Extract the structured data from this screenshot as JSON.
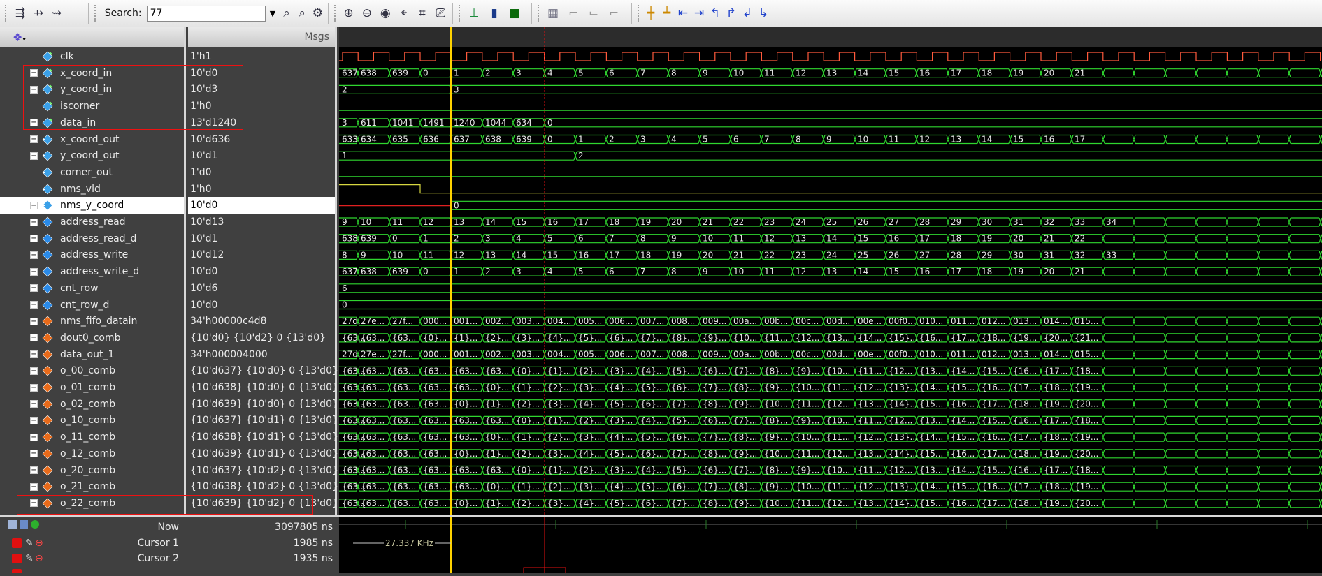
{
  "toolbar": {
    "search_label": "Search:",
    "search_value": "77",
    "group1_icons": [
      "insert-wave-icon",
      "insert-divider-icon",
      "find-signal-icon"
    ],
    "group2_icons": [
      "find-prev-icon",
      "find-next-icon",
      "find-options-icon"
    ],
    "group3_icons": [
      "wave-settings-icon"
    ],
    "group4_icons": [
      "zoom-in-icon",
      "zoom-out-icon",
      "zoom-full-icon",
      "zoom-cursor-icon",
      "zoom-region-icon",
      "zoom-last-icon"
    ],
    "group5_icons": [
      "format-literal-icon",
      "format-logic-icon",
      "format-analog-icon"
    ],
    "group6_icons": [
      "block-icon",
      "edge-rise-icon",
      "edge-fall-icon",
      "edge-both-icon"
    ],
    "group7_icons": [
      "add-cursor-icon",
      "delete-cursor-icon",
      "cursor-prev-edge-icon",
      "cursor-next-edge-icon",
      "cursor-prev-rise-icon",
      "cursor-next-rise-icon",
      "cursor-prev-fall-icon",
      "cursor-next-fall-icon"
    ]
  },
  "value_header": "Msgs",
  "signals": [
    {
      "name": "clk",
      "value": "1'h1",
      "kind": "in",
      "expandable": false,
      "wave": "clock"
    },
    {
      "name": "x_coord_in",
      "value": "10'd0",
      "kind": "in",
      "expandable": true,
      "wave": "bus",
      "segs": [
        "637",
        "638",
        "639",
        "0",
        "1",
        "2",
        "3",
        "4",
        "5",
        "6",
        "7",
        "8",
        "9",
        "10",
        "11",
        "12",
        "13",
        "14",
        "15",
        "16",
        "17",
        "18",
        "19",
        "20",
        "21"
      ]
    },
    {
      "name": "y_coord_in",
      "value": "10'd3",
      "kind": "in",
      "expandable": true,
      "wave": "bus2",
      "first": "2",
      "second": "3"
    },
    {
      "name": "iscorner",
      "value": "1'h0",
      "kind": "in",
      "expandable": false,
      "wave": "low"
    },
    {
      "name": "data_in",
      "value": "13'd1240",
      "kind": "in",
      "expandable": true,
      "wave": "data",
      "segs": [
        "3",
        "611",
        "1041",
        "1491",
        "1240",
        "1044",
        "634",
        "0"
      ]
    },
    {
      "name": "x_coord_out",
      "value": "10'd636",
      "kind": "out",
      "expandable": true,
      "wave": "busx",
      "segs": [
        "633",
        "634",
        "635",
        "636",
        "637",
        "638",
        "639",
        "0",
        "1",
        "2",
        "3",
        "4",
        "5",
        "6",
        "7",
        "8",
        "9",
        "10",
        "11",
        "12",
        "13",
        "14",
        "15",
        "16",
        "17"
      ]
    },
    {
      "name": "y_coord_out",
      "value": "10'd1",
      "kind": "out",
      "expandable": true,
      "wave": "ybus",
      "first": "1",
      "second": "2"
    },
    {
      "name": "corner_out",
      "value": "1'd0",
      "kind": "out",
      "expandable": false,
      "wave": "low"
    },
    {
      "name": "nms_vld",
      "value": "1'h0",
      "kind": "out",
      "expandable": false,
      "wave": "vld"
    },
    {
      "name": "nms_y_coord",
      "value": "10'd0",
      "kind": "out",
      "expandable": true,
      "wave": "nmsy",
      "first": "0",
      "selected": true
    },
    {
      "name": "address_read",
      "value": "10'd13",
      "kind": "int",
      "expandable": true,
      "wave": "bus",
      "segs": [
        "9",
        "10",
        "11",
        "12",
        "13",
        "14",
        "15",
        "16",
        "17",
        "18",
        "19",
        "20",
        "21",
        "22",
        "23",
        "24",
        "25",
        "26",
        "27",
        "28",
        "29",
        "30",
        "31",
        "32",
        "33",
        "34"
      ]
    },
    {
      "name": "address_read_d",
      "value": "10'd1",
      "kind": "int",
      "expandable": true,
      "wave": "bus",
      "segs": [
        "638",
        "639",
        "0",
        "1",
        "2",
        "3",
        "4",
        "5",
        "6",
        "7",
        "8",
        "9",
        "10",
        "11",
        "12",
        "13",
        "14",
        "15",
        "16",
        "17",
        "18",
        "19",
        "20",
        "21",
        "22"
      ]
    },
    {
      "name": "address_write",
      "value": "10'd12",
      "kind": "int",
      "expandable": true,
      "wave": "bus",
      "segs": [
        "8",
        "9",
        "10",
        "11",
        "12",
        "13",
        "14",
        "15",
        "16",
        "17",
        "18",
        "19",
        "20",
        "21",
        "22",
        "23",
        "24",
        "25",
        "26",
        "27",
        "28",
        "29",
        "30",
        "31",
        "32",
        "33"
      ]
    },
    {
      "name": "address_write_d",
      "value": "10'd0",
      "kind": "int",
      "expandable": true,
      "wave": "bus",
      "segs": [
        "637",
        "638",
        "639",
        "0",
        "1",
        "2",
        "3",
        "4",
        "5",
        "6",
        "7",
        "8",
        "9",
        "10",
        "11",
        "12",
        "13",
        "14",
        "15",
        "16",
        "17",
        "18",
        "19",
        "20",
        "21"
      ]
    },
    {
      "name": "cnt_row",
      "value": "10'd6",
      "kind": "int",
      "expandable": true,
      "wave": "const",
      "first": "6"
    },
    {
      "name": "cnt_row_d",
      "value": "10'd0",
      "kind": "int",
      "expandable": true,
      "wave": "const",
      "first": "0"
    },
    {
      "name": "nms_fifo_datain",
      "value": "34'h00000c4d8",
      "kind": "reg",
      "expandable": true,
      "wave": "bus",
      "segs": [
        "27d...",
        "27e...",
        "27f...",
        "000...",
        "001...",
        "002...",
        "003...",
        "004...",
        "005...",
        "006...",
        "007...",
        "008...",
        "009...",
        "00a...",
        "00b...",
        "00c...",
        "00d...",
        "00e...",
        "00f0...",
        "010...",
        "011...",
        "012...",
        "013...",
        "014...",
        "015..."
      ]
    },
    {
      "name": "dout0_comb",
      "value": "{10'd0} {10'd2} 0 {13'd0}",
      "kind": "reg",
      "expandable": true,
      "wave": "bus",
      "segs": [
        "{63...",
        "{63...",
        "{63...",
        "{0}...",
        "{1}...",
        "{2}...",
        "{3}...",
        "{4}...",
        "{5}...",
        "{6}...",
        "{7}...",
        "{8}...",
        "{9}...",
        "{10...",
        "{11...",
        "{12...",
        "{13...",
        "{14...",
        "{15}...",
        "{16...",
        "{17...",
        "{18...",
        "{19...",
        "{20...",
        "{21..."
      ]
    },
    {
      "name": "data_out_1",
      "value": "34'h000004000",
      "kind": "reg",
      "expandable": true,
      "wave": "bus",
      "segs": [
        "27d...",
        "27e...",
        "27f...",
        "000...",
        "001...",
        "002...",
        "003...",
        "004...",
        "005...",
        "006...",
        "007...",
        "008...",
        "009...",
        "00a...",
        "00b...",
        "00c...",
        "00d...",
        "00e...",
        "00f0...",
        "010...",
        "011...",
        "012...",
        "013...",
        "014...",
        "015..."
      ]
    },
    {
      "name": "o_00_comb",
      "value": "{10'd637} {10'd0} 0 {13'd0}",
      "kind": "reg",
      "expandable": true,
      "wave": "bus",
      "segs": [
        "{63...",
        "{63...",
        "{63...",
        "{63...",
        "{63...",
        "{63...",
        "{0}...",
        "{1}...",
        "{2}...",
        "{3}...",
        "{4}...",
        "{5}...",
        "{6}...",
        "{7}...",
        "{8}...",
        "{9}...",
        "{10...",
        "{11...",
        "{12...",
        "{13...",
        "{14...",
        "{15...",
        "{16...",
        "{17...",
        "{18..."
      ]
    },
    {
      "name": "o_01_comb",
      "value": "{10'd638} {10'd0} 0 {13'd0}",
      "kind": "reg",
      "expandable": true,
      "wave": "bus",
      "segs": [
        "{63...",
        "{63...",
        "{63...",
        "{63...",
        "{63...",
        "{0}...",
        "{1}...",
        "{2}...",
        "{3}...",
        "{4}...",
        "{5}...",
        "{6}...",
        "{7}...",
        "{8}...",
        "{9}...",
        "{10...",
        "{11...",
        "{12...",
        "{13}...",
        "{14...",
        "{15...",
        "{16...",
        "{17...",
        "{18...",
        "{19..."
      ]
    },
    {
      "name": "o_02_comb",
      "value": "{10'd639} {10'd0} 0 {13'd0}",
      "kind": "reg",
      "expandable": true,
      "wave": "bus",
      "segs": [
        "{63...",
        "{63...",
        "{63...",
        "{63...",
        "{0}...",
        "{1}...",
        "{2}...",
        "{3}...",
        "{4}...",
        "{5}...",
        "{6}...",
        "{7}...",
        "{8}...",
        "{9}...",
        "{10...",
        "{11...",
        "{12...",
        "{13...",
        "{14}...",
        "{15...",
        "{16...",
        "{17...",
        "{18...",
        "{19...",
        "{20..."
      ]
    },
    {
      "name": "o_10_comb",
      "value": "{10'd637} {10'd1} 0 {13'd0}",
      "kind": "reg",
      "expandable": true,
      "wave": "bus",
      "segs": [
        "{63...",
        "{63...",
        "{63...",
        "{63...",
        "{63...",
        "{63...",
        "{0}...",
        "{1}...",
        "{2}...",
        "{3}...",
        "{4}...",
        "{5}...",
        "{6}...",
        "{7}...",
        "{8}...",
        "{9}...",
        "{10...",
        "{11...",
        "{12...",
        "{13...",
        "{14...",
        "{15...",
        "{16...",
        "{17...",
        "{18..."
      ]
    },
    {
      "name": "o_11_comb",
      "value": "{10'd638} {10'd1} 0 {13'd0}",
      "kind": "reg",
      "expandable": true,
      "wave": "bus",
      "segs": [
        "{63...",
        "{63...",
        "{63...",
        "{63...",
        "{63...",
        "{0}...",
        "{1}...",
        "{2}...",
        "{3}...",
        "{4}...",
        "{5}...",
        "{6}...",
        "{7}...",
        "{8}...",
        "{9}...",
        "{10...",
        "{11...",
        "{12...",
        "{13}...",
        "{14...",
        "{15...",
        "{16...",
        "{17...",
        "{18...",
        "{19..."
      ]
    },
    {
      "name": "o_12_comb",
      "value": "{10'd639} {10'd1} 0 {13'd0}",
      "kind": "reg",
      "expandable": true,
      "wave": "bus",
      "segs": [
        "{63...",
        "{63...",
        "{63...",
        "{63...",
        "{0}...",
        "{1}...",
        "{2}...",
        "{3}...",
        "{4}...",
        "{5}...",
        "{6}...",
        "{7}...",
        "{8}...",
        "{9}...",
        "{10...",
        "{11...",
        "{12...",
        "{13...",
        "{14}...",
        "{15...",
        "{16...",
        "{17...",
        "{18...",
        "{19...",
        "{20..."
      ]
    },
    {
      "name": "o_20_comb",
      "value": "{10'd637} {10'd2} 0 {13'd0}",
      "kind": "reg",
      "expandable": true,
      "wave": "bus",
      "segs": [
        "{63...",
        "{63...",
        "{63...",
        "{63...",
        "{63...",
        "{63...",
        "{0}...",
        "{1}...",
        "{2}...",
        "{3}...",
        "{4}...",
        "{5}...",
        "{6}...",
        "{7}...",
        "{8}...",
        "{9}...",
        "{10...",
        "{11...",
        "{12...",
        "{13...",
        "{14...",
        "{15...",
        "{16...",
        "{17...",
        "{18..."
      ]
    },
    {
      "name": "o_21_comb",
      "value": "{10'd638} {10'd2} 0 {13'd0}",
      "kind": "reg",
      "expandable": true,
      "wave": "bus",
      "segs": [
        "{63...",
        "{63...",
        "{63...",
        "{63...",
        "{63...",
        "{0}...",
        "{1}...",
        "{2}...",
        "{3}...",
        "{4}...",
        "{5}...",
        "{6}...",
        "{7}...",
        "{8}...",
        "{9}...",
        "{10...",
        "{11...",
        "{12...",
        "{13}...",
        "{14...",
        "{15...",
        "{16...",
        "{17...",
        "{18...",
        "{19..."
      ]
    },
    {
      "name": "o_22_comb",
      "value": "{10'd639} {10'd2} 0 {13'd0}",
      "kind": "reg",
      "expandable": true,
      "wave": "bus",
      "segs": [
        "{63...",
        "{63...",
        "{63...",
        "{63...",
        "{0}...",
        "{1}...",
        "{2}...",
        "{3}...",
        "{4}...",
        "{5}...",
        "{6}...",
        "{7}...",
        "{8}...",
        "{9}...",
        "{10...",
        "{11...",
        "{12...",
        "{13...",
        "{14}...",
        "{15...",
        "{16...",
        "{17...",
        "{18...",
        "{19...",
        "{20..."
      ]
    }
  ],
  "cursors": {
    "now_label": "Now",
    "now_value": "3097805 ns",
    "cursor1_label": "Cursor 1",
    "cursor1_value": "1985 ns",
    "cursor2_label": "Cursor 2",
    "cursor2_value": "1935 ns",
    "freq_label": "27.337 KHz"
  },
  "colors": {
    "wave_green": "#2fd62f",
    "clock_red": "#ff5a3c",
    "nms_vld_yellow": "#d6d640",
    "cursor1_yellow": "#ffd200",
    "cursor2_red": "#e01010",
    "highlight_box": "#e01010",
    "selected_row_bg": "#ffffff"
  }
}
